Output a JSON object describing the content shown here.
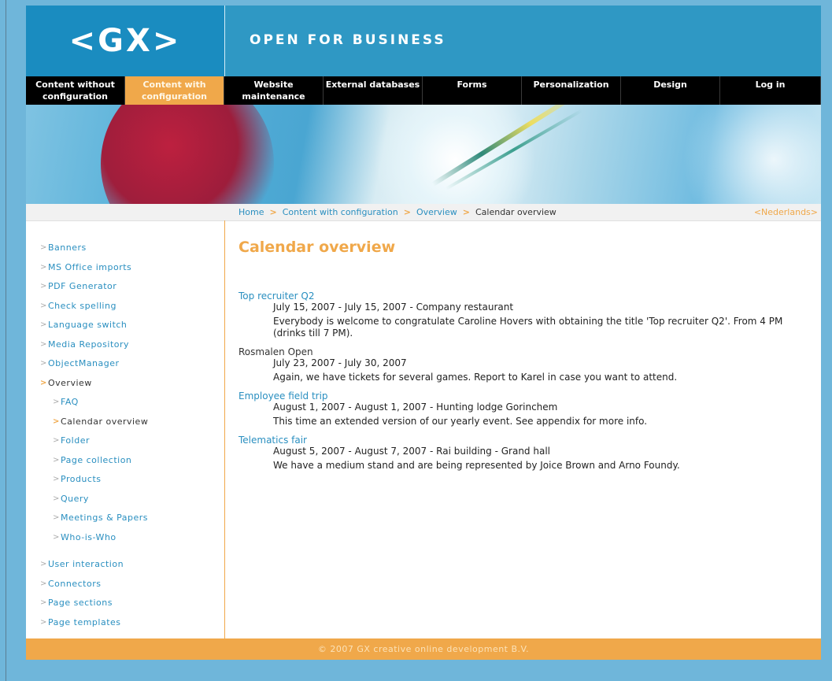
{
  "header": {
    "logo_text": "<GX>",
    "tagline": "OPEN FOR BUSINESS"
  },
  "nav": {
    "items": [
      {
        "label_line1": "Content without",
        "label_line2": "configuration",
        "active": false
      },
      {
        "label_line1": "Content with",
        "label_line2": "configuration",
        "active": true
      },
      {
        "label_line1": "Website",
        "label_line2": "maintenance",
        "active": false
      },
      {
        "label_line1": "External databases",
        "label_line2": "",
        "active": false
      },
      {
        "label_line1": "Forms",
        "label_line2": "",
        "active": false
      },
      {
        "label_line1": "Personalization",
        "label_line2": "",
        "active": false
      },
      {
        "label_line1": "Design",
        "label_line2": "",
        "active": false
      },
      {
        "label_line1": "Log in",
        "label_line2": "",
        "active": false
      }
    ]
  },
  "breadcrumb": {
    "items": [
      "Home",
      "Content with configuration",
      "Overview"
    ],
    "separator": ">",
    "current": "Calendar overview",
    "language_link": "<Nederlands>"
  },
  "sidebar": {
    "arrow": ">",
    "items": [
      {
        "label": "Banners"
      },
      {
        "label": "MS Office imports"
      },
      {
        "label": "PDF Generator"
      },
      {
        "label": "Check spelling"
      },
      {
        "label": "Language switch"
      },
      {
        "label": "Media Repository"
      },
      {
        "label": "ObjectManager"
      },
      {
        "label": "Overview"
      }
    ],
    "subitems": [
      {
        "label": "FAQ"
      },
      {
        "label": "Calendar overview"
      },
      {
        "label": "Folder"
      },
      {
        "label": "Page collection"
      },
      {
        "label": "Products"
      },
      {
        "label": "Query"
      },
      {
        "label": "Meetings & Papers"
      },
      {
        "label": "Who-is-Who"
      }
    ],
    "items_after": [
      {
        "label": "User interaction"
      },
      {
        "label": "Connectors"
      },
      {
        "label": "Page sections"
      },
      {
        "label": "Page templates"
      }
    ]
  },
  "main": {
    "title": "Calendar overview",
    "events": [
      {
        "title": "Top recruiter Q2",
        "date": "July 15, 2007 - July 15, 2007 - Company restaurant",
        "description": "Everybody is welcome to congratulate Caroline Hovers with obtaining the title 'Top recruiter Q2'. From 4 PM (drinks till 7 PM).",
        "linked": true
      },
      {
        "title": "Rosmalen Open",
        "date": "July 23, 2007 - July 30, 2007",
        "description": "Again, we have tickets for several games. Report to Karel in case you want to attend.",
        "linked": false
      },
      {
        "title": "Employee field trip",
        "date": "August 1, 2007 - August 1, 2007 - Hunting lodge Gorinchem",
        "description": "This time an extended version of our yearly event. See appendix for more info.",
        "linked": true
      },
      {
        "title": "Telematics fair",
        "date": "August 5, 2007 - August 7, 2007 - Rai building - Grand hall",
        "description": "We have a medium stand and are being represented by Joice Brown and Arno Foundy.",
        "linked": true
      }
    ]
  },
  "footer": {
    "text": "© 2007 GX creative online development B.V."
  },
  "colors": {
    "brand_blue": "#1a8cc0",
    "accent_orange": "#f0a84a",
    "link_blue": "#2a8fc0",
    "nav_black": "#000000"
  }
}
